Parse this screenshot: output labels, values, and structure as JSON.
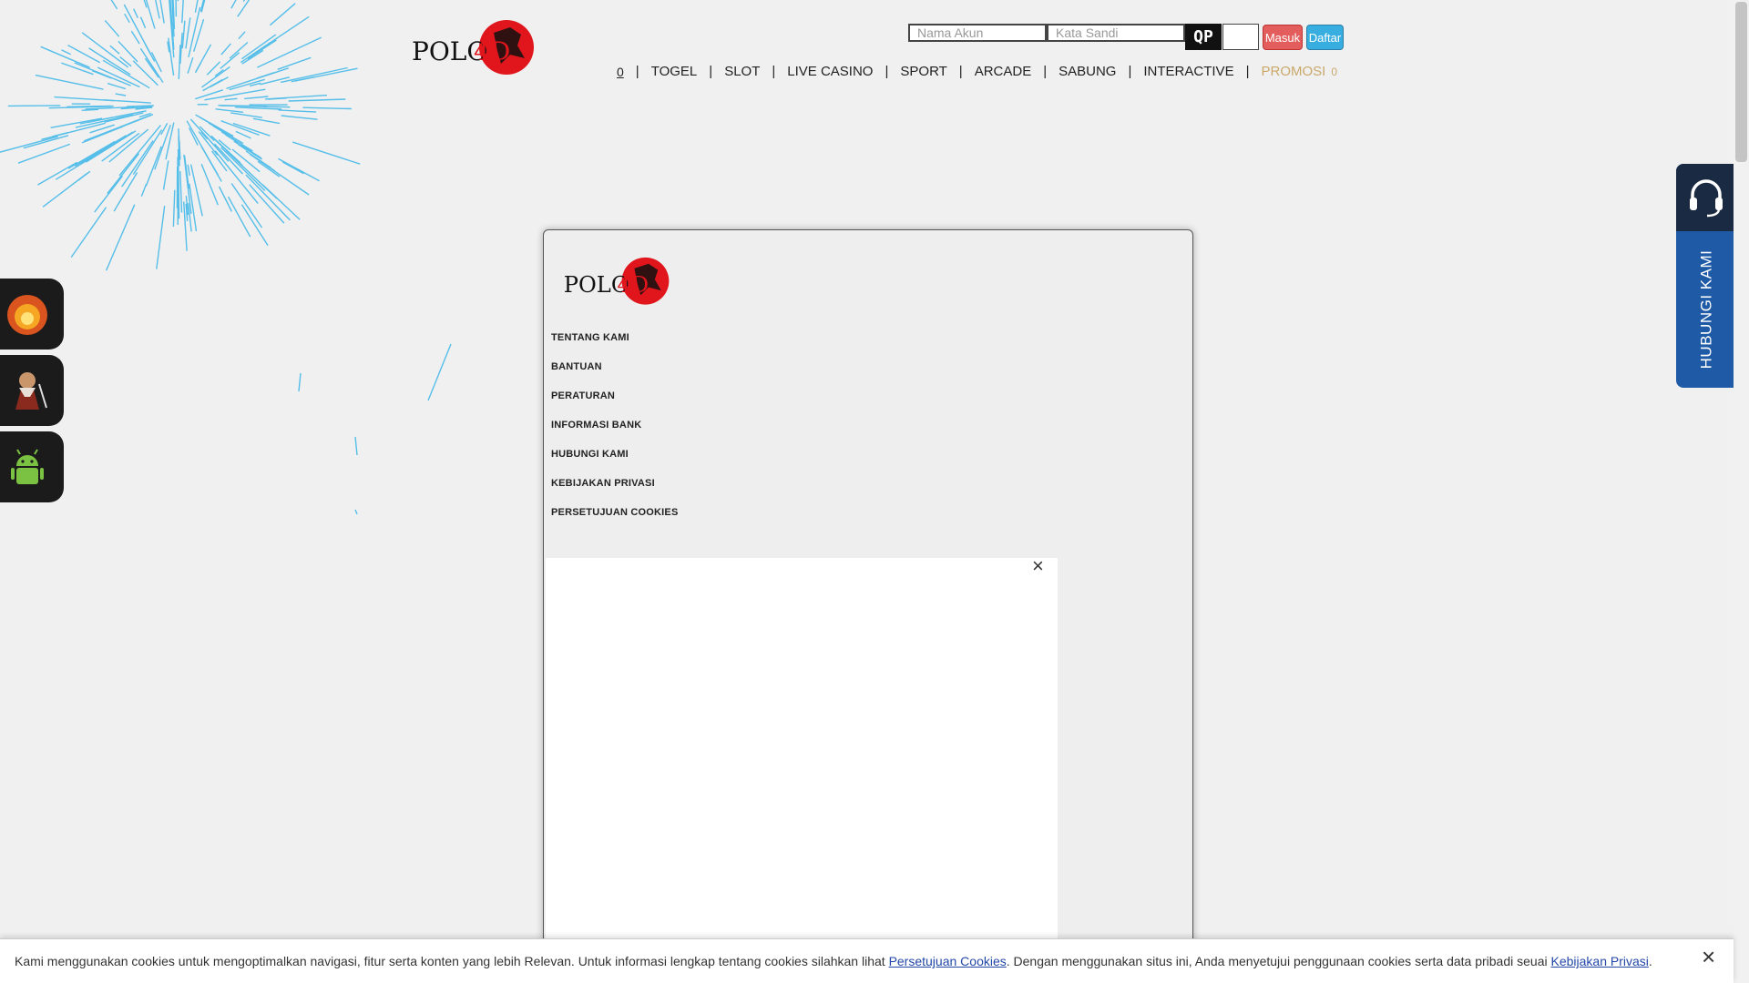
{
  "brand": {
    "logo_text": "POLO",
    "logo_accent": "4D",
    "accent_color": "#e0161c"
  },
  "login": {
    "username_placeholder": "Nama Akun",
    "password_placeholder": "Kata Sandi",
    "captcha_text": "QP",
    "login_label": "Masuk",
    "register_label": "Daftar"
  },
  "nav": {
    "home_icon": "0",
    "items": [
      "TOGEL",
      "SLOT",
      "LIVE CASINO",
      "SPORT",
      "ARCADE",
      "SABUNG",
      "INTERACTIVE"
    ],
    "promo": "PROMOSI",
    "promo_icon": "0"
  },
  "contact": {
    "label": "HUBUNGI KAMI",
    "icon": "headset-icon"
  },
  "side_tiles": [
    "fire-character-icon",
    "warrior-character-icon",
    "android-icon"
  ],
  "modal": {
    "links": [
      "TENTANG KAMI",
      "BANTUAN",
      "PERATURAN",
      "INFORMASI BANK",
      "HUBUNGI KAMI",
      "KEBIJAKAN PRIVASI",
      "PERSETUJUAN COOKIES"
    ],
    "close_symbol": "×"
  },
  "cookie": {
    "text_1": "Kami menggunakan cookies untuk mengoptimalkan navigasi, fitur serta konten yang lebih Relevan. Untuk informasi lengkap tentang cookies silahkan lihat ",
    "link_1": "Persetujuan Cookies",
    "text_2": ". Dengan menggunakan situs ini, Anda menyetujui penggunaan cookies serta data pribadi seuai ",
    "link_2": "Kebijakan Privasi",
    "text_3": ".",
    "close_symbol": "×"
  }
}
